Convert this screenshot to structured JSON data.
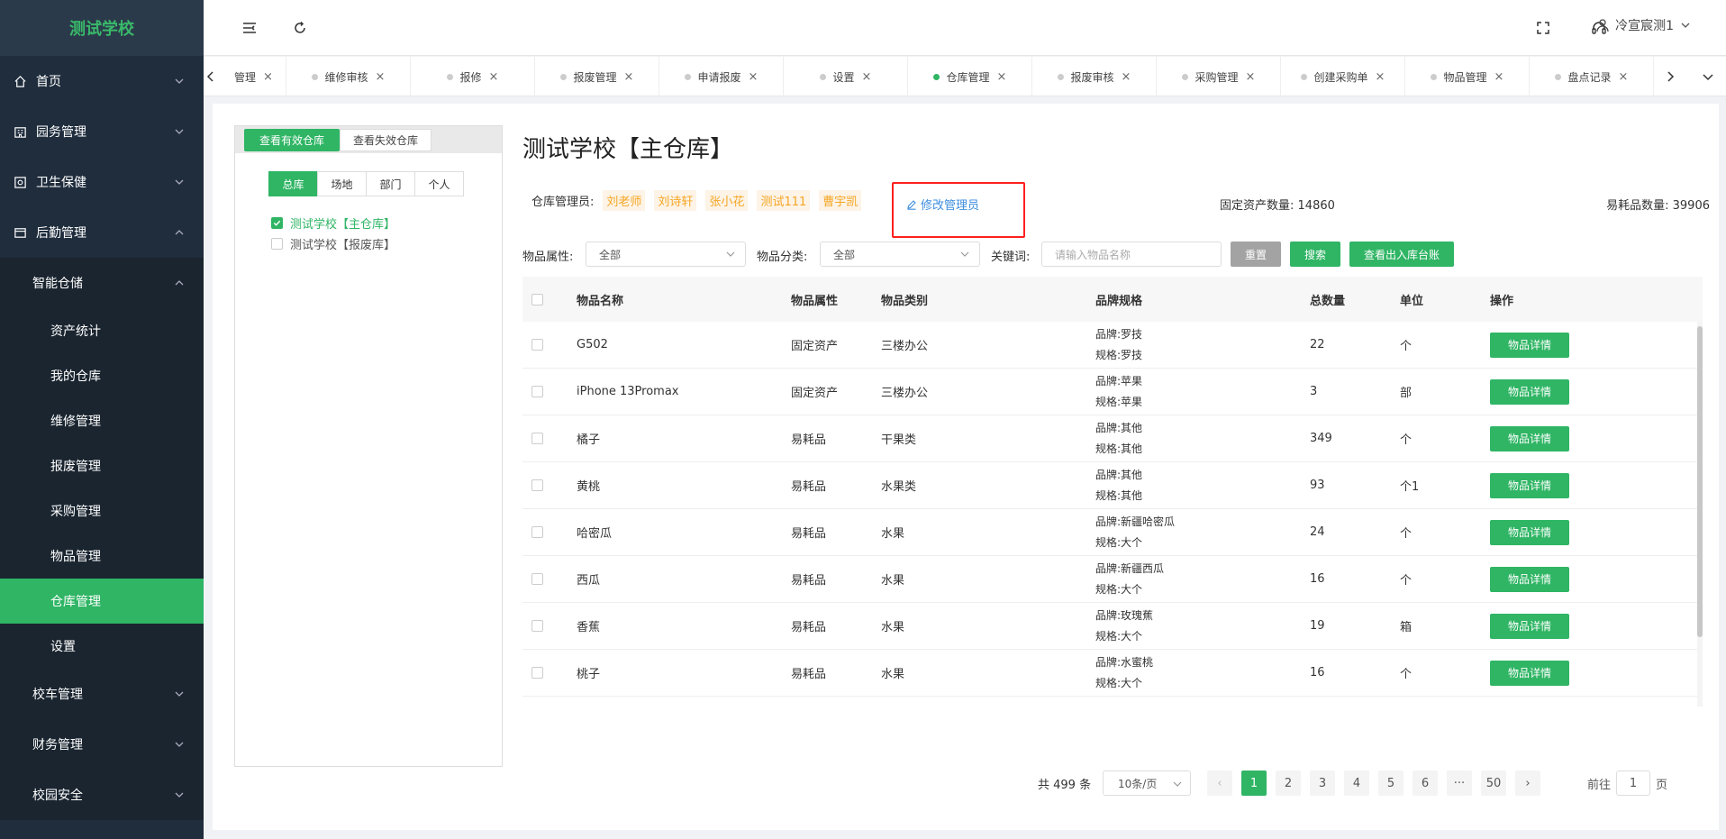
{
  "app": {
    "logo": "测试学校"
  },
  "sidebar": {
    "items": [
      {
        "label": "首页",
        "icon": "home-icon"
      },
      {
        "label": "园务管理",
        "icon": "building-icon"
      },
      {
        "label": "卫生保健",
        "icon": "health-icon"
      },
      {
        "label": "后勤管理",
        "icon": "logistics-icon"
      }
    ],
    "sub": {
      "label": "智能仓储"
    },
    "sub_items": [
      "资产统计",
      "我的仓库",
      "维修管理",
      "报废管理",
      "采购管理",
      "物品管理",
      "仓库管理",
      "设置"
    ],
    "bottom_items": [
      "校车管理",
      "财务管理",
      "校园安全"
    ]
  },
  "header": {
    "user": "冷宣宸测1"
  },
  "tabs": [
    "管理",
    "维修审核",
    "报修",
    "报废管理",
    "申请报废",
    "设置",
    "仓库管理",
    "报废审核",
    "采购管理",
    "创建采购单",
    "物品管理",
    "盘点记录"
  ],
  "left_panel": {
    "btn_valid": "查看有效仓库",
    "btn_invalid": "查看失效仓库",
    "segments": [
      "总库",
      "场地",
      "部门",
      "个人"
    ],
    "tree": [
      "测试学校【主仓库】",
      "测试学校【报废库】"
    ]
  },
  "content": {
    "title": "测试学校【主仓库】",
    "manager_label": "仓库管理员:",
    "managers": [
      "刘老师",
      "刘诗轩",
      "张小花",
      "测试111",
      "曹宇凯"
    ],
    "edit_label": "修改管理员",
    "fixed_label": "固定资产数量:",
    "fixed_value": "14860",
    "consumable_label": "易耗品数量:",
    "consumable_value": "39906"
  },
  "filters": {
    "attr_label": "物品属性:",
    "attr_value": "全部",
    "cat_label": "物品分类:",
    "cat_value": "全部",
    "kw_label": "关键词:",
    "kw_placeholder": "请输入物品名称",
    "reset": "重置",
    "search": "搜索",
    "ledger": "查看出入库台账"
  },
  "table": {
    "headers": [
      "物品名称",
      "物品属性",
      "物品类别",
      "品牌规格",
      "总数量",
      "单位",
      "操作"
    ],
    "action_label": "物品详情",
    "brand_prefix": "品牌:",
    "spec_prefix": "规格:",
    "rows": [
      {
        "name": "G502",
        "attr": "固定资产",
        "cat": "三楼办公",
        "brand": "品牌:罗技",
        "spec": "规格:罗技",
        "qty": "22",
        "unit": "个"
      },
      {
        "name": "iPhone 13Promax",
        "attr": "固定资产",
        "cat": "三楼办公",
        "brand": "品牌:苹果",
        "spec": "规格:苹果",
        "qty": "3",
        "unit": "部"
      },
      {
        "name": "橘子",
        "attr": "易耗品",
        "cat": "干果类",
        "brand": "品牌:其他",
        "spec": "规格:其他",
        "qty": "349",
        "unit": "个"
      },
      {
        "name": "黄桃",
        "attr": "易耗品",
        "cat": "水果类",
        "brand": "品牌:其他",
        "spec": "规格:其他",
        "qty": "93",
        "unit": "个1"
      },
      {
        "name": "哈密瓜",
        "attr": "易耗品",
        "cat": "水果",
        "brand": "品牌:新疆哈密瓜",
        "spec": "规格:大个",
        "qty": "24",
        "unit": "个"
      },
      {
        "name": "西瓜",
        "attr": "易耗品",
        "cat": "水果",
        "brand": "品牌:新疆西瓜",
        "spec": "规格:大个",
        "qty": "16",
        "unit": "个"
      },
      {
        "name": "香蕉",
        "attr": "易耗品",
        "cat": "水果",
        "brand": "品牌:玫瑰蕉",
        "spec": "规格:大个",
        "qty": "19",
        "unit": "箱"
      },
      {
        "name": "桃子",
        "attr": "易耗品",
        "cat": "水果",
        "brand": "品牌:水蜜桃",
        "spec": "规格:大个",
        "qty": "16",
        "unit": "个"
      }
    ]
  },
  "pagination": {
    "total": "共 499 条",
    "page_size": "10条/页",
    "pages": [
      "1",
      "2",
      "3",
      "4",
      "5",
      "6",
      "···",
      "50"
    ],
    "goto_label": "前往",
    "goto_value": "1",
    "page_suffix": "页"
  },
  "colors": {
    "accent": "#2fb564",
    "sidebar": "#1f2d3d",
    "highlight": "#ff1f1f",
    "link": "#3c8dde",
    "tag": "#f5a623"
  }
}
